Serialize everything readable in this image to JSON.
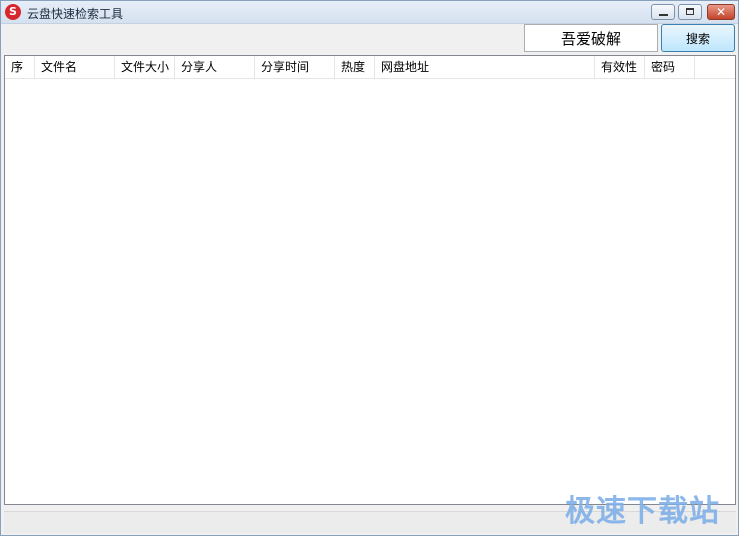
{
  "window": {
    "title": "云盘快速检索工具",
    "icon": "app-s-logo-icon",
    "controls": {
      "minimize": "minimize-icon",
      "maximize": "maximize-icon",
      "close": "close-icon",
      "close_glyph": "✕"
    }
  },
  "toolbar": {
    "search_value": "吾爱破解",
    "search_label": "搜索"
  },
  "table": {
    "columns": [
      "序",
      "文件名",
      "文件大小",
      "分享人",
      "分享时间",
      "热度",
      "网盘地址",
      "有效性",
      "密码"
    ],
    "rows": []
  },
  "watermark": "极速下载站",
  "colors": {
    "title_gradient_top": "#e6eef8",
    "close_button": "#c4432b",
    "watermark": "#7fb0e8"
  }
}
